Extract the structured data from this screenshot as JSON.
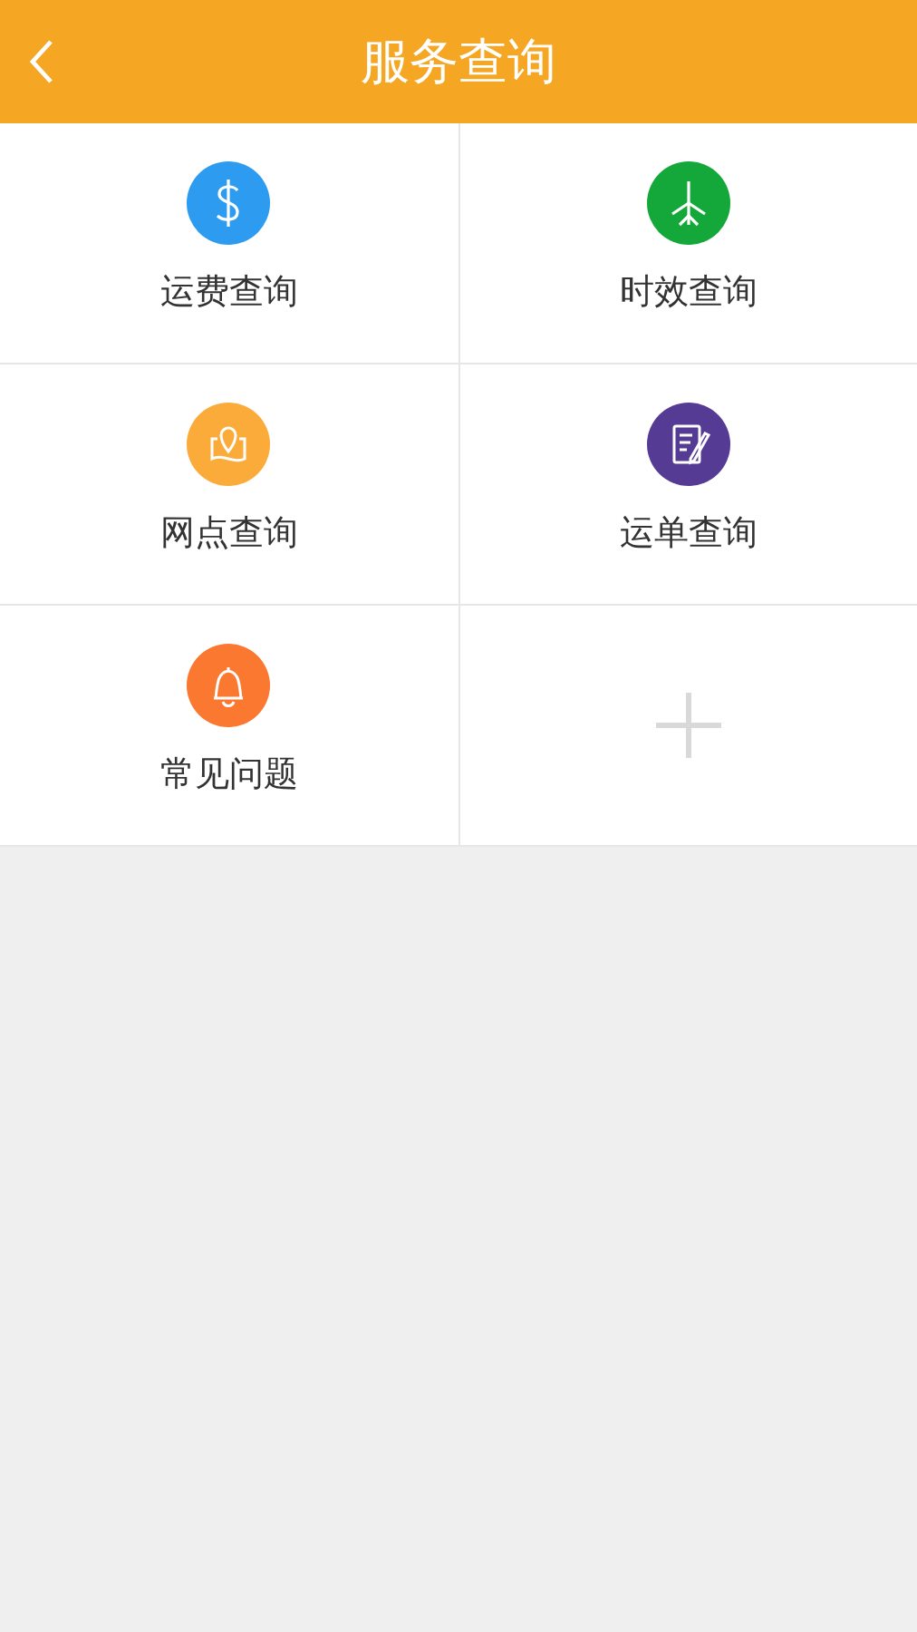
{
  "header": {
    "title": "服务查询"
  },
  "tiles": [
    {
      "kind": "dollar",
      "label": "运费查询",
      "color": "#2d9cf0"
    },
    {
      "kind": "plane",
      "label": "时效查询",
      "color": "#14a83a"
    },
    {
      "kind": "map",
      "label": "网点查询",
      "color": "#fbab3a"
    },
    {
      "kind": "note",
      "label": "运单查询",
      "color": "#553b94"
    },
    {
      "kind": "bell",
      "label": "常见问题",
      "color": "#fb7830"
    },
    {
      "kind": "add"
    }
  ]
}
